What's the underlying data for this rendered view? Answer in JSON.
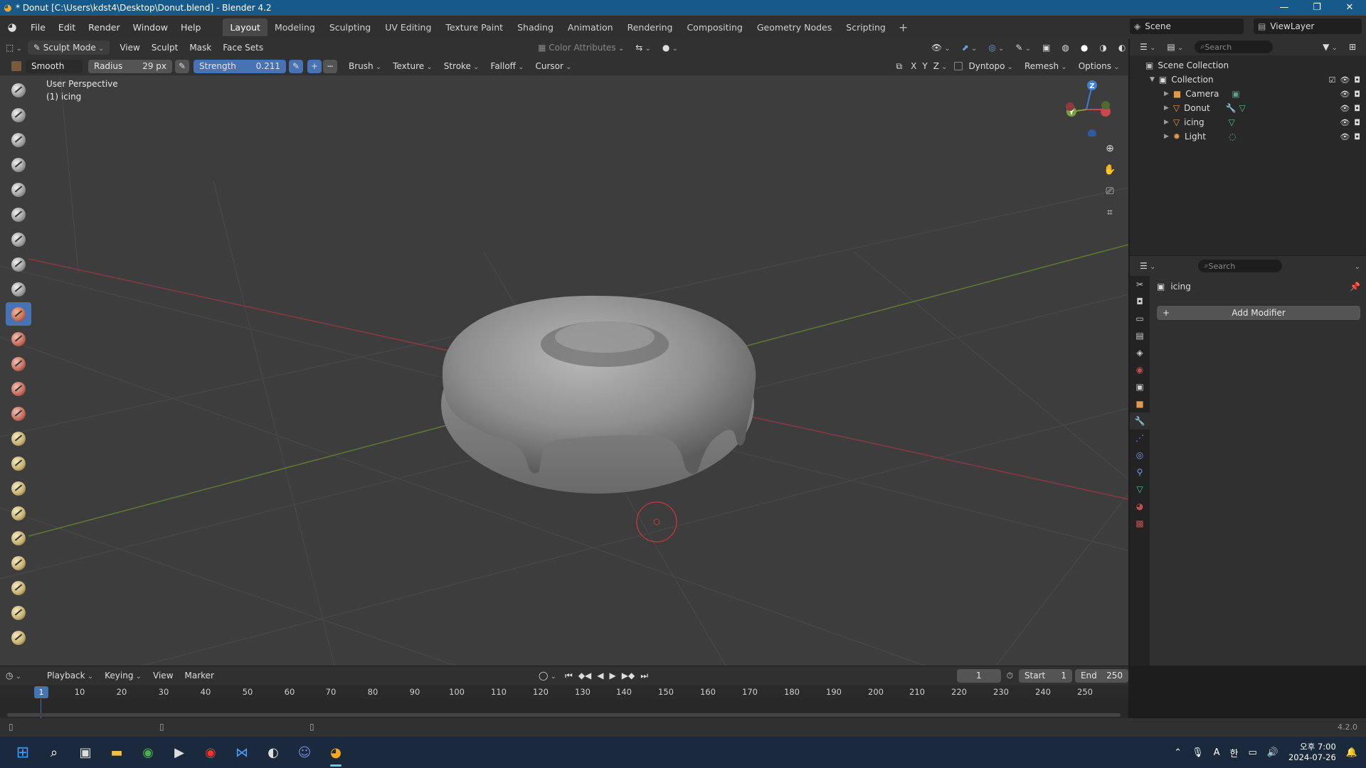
{
  "title_bar": {
    "title": "* Donut [C:\\Users\\kdst4\\Desktop\\Donut.blend] - Blender 4.2",
    "minimize": "—",
    "maximize": "❐",
    "close": "✕"
  },
  "menu": [
    "File",
    "Edit",
    "Render",
    "Window",
    "Help"
  ],
  "workspaces": [
    "Layout",
    "Modeling",
    "Sculpting",
    "UV Editing",
    "Texture Paint",
    "Shading",
    "Animation",
    "Rendering",
    "Compositing",
    "Geometry Nodes",
    "Scripting"
  ],
  "active_workspace": "Layout",
  "scene": {
    "name": "Scene",
    "view_layer": "ViewLayer"
  },
  "viewport_header": {
    "mode": "Sculpt Mode",
    "menus": [
      "View",
      "Sculpt",
      "Mask",
      "Face Sets"
    ],
    "color_attributes": "Color Attributes"
  },
  "tool_header": {
    "brush_name": "Smooth",
    "radius_label": "Radius",
    "radius_value": "29 px",
    "strength_label": "Strength",
    "strength_value": "0.211",
    "dropdowns": [
      "Brush",
      "Texture",
      "Stroke",
      "Falloff",
      "Cursor"
    ],
    "axes": [
      "X",
      "Y",
      "Z"
    ],
    "dyntopo": "Dyntopo",
    "remesh": "Remesh",
    "options": "Options"
  },
  "viewport_info": {
    "line1": "User Perspective",
    "line2": "(1) icing"
  },
  "gizmo": {
    "x": "X",
    "y": "Y",
    "z": "Z"
  },
  "outliner": {
    "search_placeholder": "Search",
    "scene_collection": "Scene Collection",
    "collection": "Collection",
    "objects": [
      "Camera",
      "Donut",
      "icing",
      "Light"
    ]
  },
  "properties": {
    "search_placeholder": "Search",
    "object_name": "icing",
    "add_modifier": "Add Modifier"
  },
  "timeline": {
    "menus": [
      "Playback",
      "Keying",
      "View",
      "Marker"
    ],
    "current_frame": "1",
    "start_label": "Start",
    "start_value": "1",
    "end_label": "End",
    "end_value": "250",
    "ruler": [
      "1",
      "10",
      "20",
      "30",
      "40",
      "50",
      "60",
      "70",
      "80",
      "90",
      "100",
      "110",
      "120",
      "130",
      "140",
      "150",
      "160",
      "170",
      "180",
      "190",
      "200",
      "210",
      "220",
      "230",
      "240",
      "250"
    ]
  },
  "status": {
    "version": "4.2.0"
  },
  "taskbar": {
    "ime": "A",
    "ime2": "한",
    "time": "오후 7:00",
    "date": "2024-07-26"
  },
  "colors": {
    "accent": "#4772b3",
    "x_axis": "#c7484d",
    "y_axis": "#7aa13c",
    "z_axis": "#3d7fd6"
  }
}
